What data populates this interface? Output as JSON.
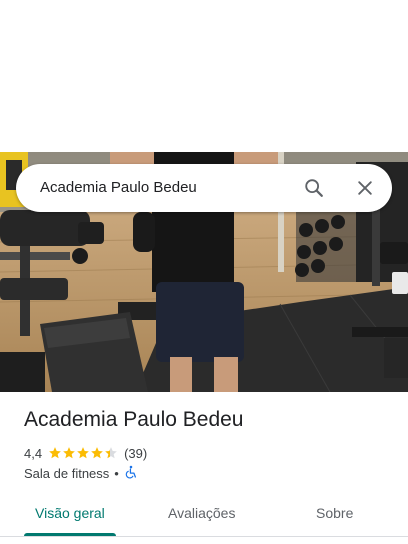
{
  "search": {
    "query": "Academia Paulo Bedeu",
    "search_icon": "search-icon",
    "close_icon": "close-icon"
  },
  "place": {
    "name": "Academia Paulo Bedeu",
    "rating": "4,4",
    "stars": 4.4,
    "review_count": "(39)",
    "category": "Sala de fitness",
    "separator": "•",
    "accessibility_icon": "wheelchair-icon"
  },
  "tabs": [
    {
      "label": "Visão geral",
      "active": true
    },
    {
      "label": "Avaliações",
      "active": false
    },
    {
      "label": "Sobre",
      "active": false
    }
  ],
  "colors": {
    "accent": "#01796f",
    "star": "#fbbc04",
    "accessibility": "#1a73e8"
  }
}
